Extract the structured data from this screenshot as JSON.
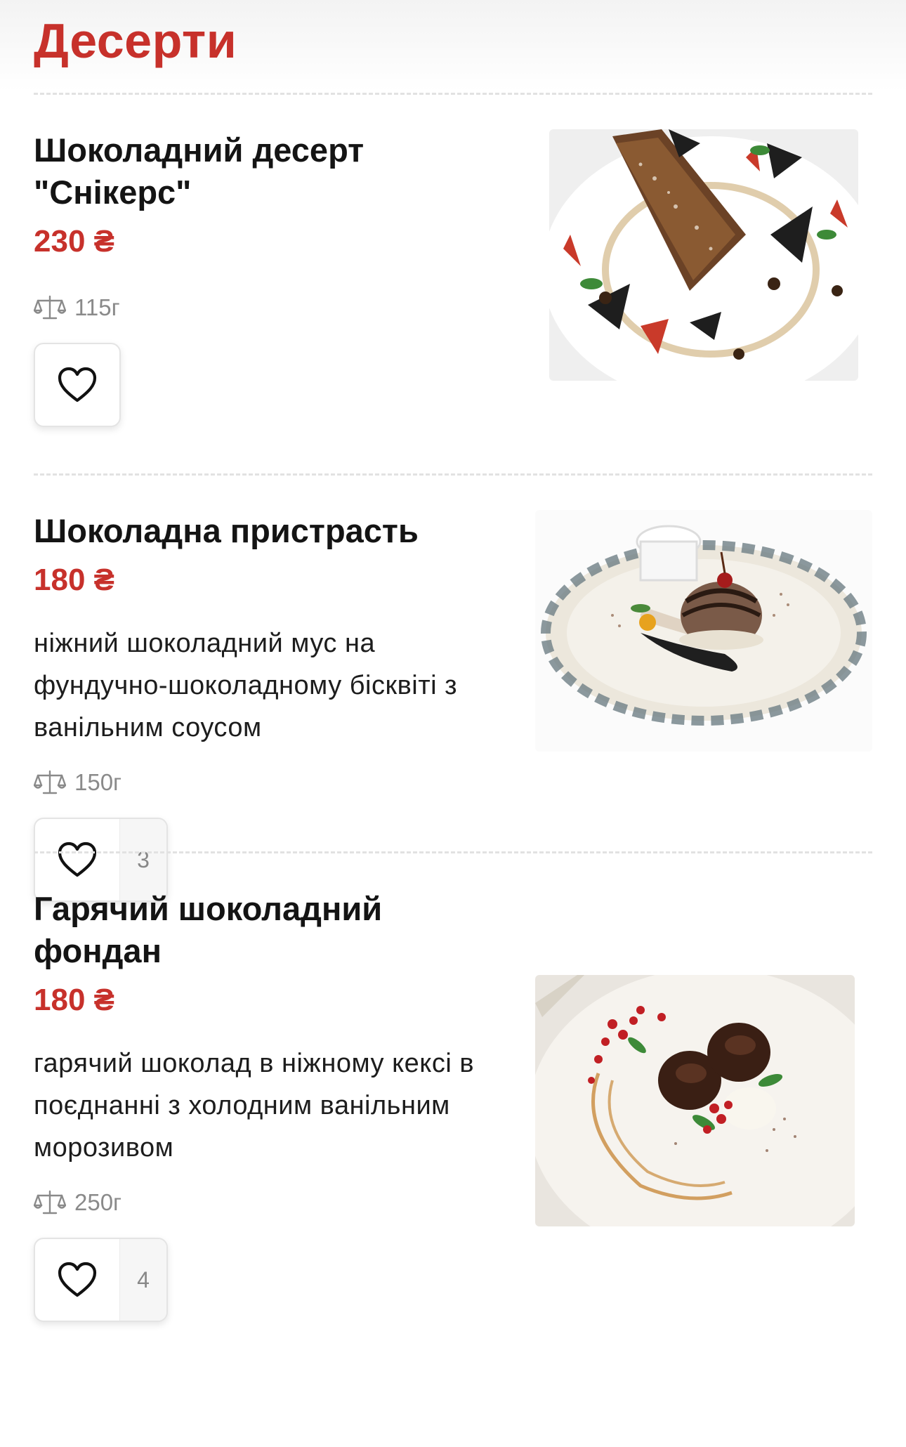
{
  "section": {
    "title": "Десерти"
  },
  "items": [
    {
      "name": "Шоколадний десерт \"Снікерс\"",
      "price": "230 ₴",
      "description": "",
      "weight": "115г",
      "likes": "",
      "image": "chocolate-snickers-cake-photo"
    },
    {
      "name": "Шоколадна пристрасть",
      "price": "180 ₴",
      "description": "ніжний шоколадний мус на фундучно-шоколадному бісквіті з ванільним соусом",
      "weight": "150г",
      "likes": "3",
      "image": "chocolate-mousse-plate-photo"
    },
    {
      "name": "Гарячий шоколадний фондан",
      "price": "180 ₴",
      "description": "гарячий шоколад в ніжному кексі в поєднанні з холодним ванільним морозивом",
      "weight": "250г",
      "likes": "4",
      "image": "chocolate-fondant-plate-photo"
    }
  ],
  "colors": {
    "accent": "#c7312b",
    "text": "#141414",
    "muted": "#8a8a8a",
    "divider": "#e2e2e2"
  },
  "icons": {
    "weight": "scale-icon",
    "favorite": "heart-icon"
  }
}
